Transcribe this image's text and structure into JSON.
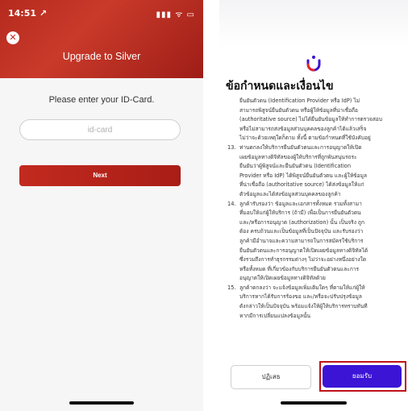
{
  "left_screen": {
    "status_time": "14:51 ↗",
    "status_icons": "▮▮▮ ᯤ ▭",
    "title": "Upgrade to Silver",
    "prompt": "Please enter your ID-Card.",
    "id_placeholder": "id-card",
    "next_label": "Next",
    "close_icon": "close-icon"
  },
  "right_screen": {
    "heading": "ข้อกำหนดและเงื่อนไข",
    "terms": [
      {
        "num": "",
        "line": "ยืนยันตัวตน (Identification Provider หรือ IdP) ไม่"
      },
      {
        "num": "",
        "line": "สามารถพิสูจน์ยืนยันตัวตน หรือผู้ให้ข้อมูลที่น่าเชื่อถือ"
      },
      {
        "num": "",
        "line": "(authoritative source) ไม่ได้ยืนยันข้อมูลให้ทำการตรวจสอบ"
      },
      {
        "num": "",
        "line": "หรือไม่สามารถส่งข้อมูลส่วนบุคคลของลูกค้าได้แล้วเสร็จ"
      },
      {
        "num": "",
        "line": "ไม่ว่าจะด้วยเหตุใดก็ตาม ทั้งนี้ ตามข้อกำหนดที่ใช้บังคับอยู่"
      },
      {
        "num": "13.",
        "line": "ท่านตกลงให้บริการยืนยันตัวตนและการอนุญาตให้เปิด"
      },
      {
        "num": "",
        "line": "เผยข้อมูลทางดิจิทัลของผู้ให้บริการที่ถูกพันสนุนรถระ"
      },
      {
        "num": "",
        "line": "ยืนยันว่าผู้พิสูจน์และยืนยันตัวตน (Identification"
      },
      {
        "num": "",
        "line": "Provider หรือ IdP) ได้พิสูจน์ยืนยันตัวตน และผู้ให้ข้อมูล"
      },
      {
        "num": "",
        "line": "ที่น่าเชื่อถือ (authoritative source) ได้ส่งข้อมูลให้แก่"
      },
      {
        "num": "",
        "line": "ตัวข้อมูลและได้ส่งข้อมูลส่วนบุคคลของลูกค้า"
      },
      {
        "num": "14.",
        "line": "ลูกค้ารับรองว่า ข้อมูลและเอกสารทั้งหมด รวมทั้งสามา"
      },
      {
        "num": "",
        "line": "ที่มอบให้แก่ผู้ให้บริการ (ถ้ามี) เพื่อเป็นการยืนยันตัวตน"
      },
      {
        "num": "",
        "line": "และ/หรือการอนุญาต (authorization) นั้น เป็นจริง ถูก"
      },
      {
        "num": "",
        "line": "ต้อง ครบถ้วนและเป็นข้อมูลที่เป็นปัจจุบัน และรับรองว่า"
      },
      {
        "num": "",
        "line": "ลูกค้ามีอำนาจและความสามารถในการสมัครใช้บริการ"
      },
      {
        "num": "",
        "line": "ยืนยันตัวตนและการอนุญาตให้เปิดเผยข้อมูลทางดิจิทัลได้"
      },
      {
        "num": "",
        "line": "ซึ่งรวมถึงการทำธุรกรรมต่างๆ ไม่ว่าจะอย่างหนึ่งอย่างใด"
      },
      {
        "num": "",
        "line": "หรือทั้งหมด ที่เกี่ยวข้องกับบริการยืนยันตัวตนและการ"
      },
      {
        "num": "",
        "line": "อนุญาตให้เปิดเผยข้อมูลทางดิจิทัลด้วย"
      },
      {
        "num": "15.",
        "line": "ลูกค้าตกลงว่า จะแจ้งข้อมูลเพิ่มเติมใดๆ ที่ตามให้แก่ผู้ให้"
      },
      {
        "num": "",
        "line": "บริการหากได้รับการร้องขอ และ/หรือจะปรับปรุงข้อมูล"
      },
      {
        "num": "",
        "line": "ดังกล่าวให้เป็นปัจจุบัน พร้อมแจ้งให้ผู้ให้บริการทราบทันที"
      },
      {
        "num": "",
        "line": "หากมีการเปลี่ยนแปลงข้อมูลนั้น"
      }
    ],
    "decline_label": "ปฏิเสธ",
    "accept_label": "ยอมรับ",
    "accent_color": "#3b14d6",
    "highlight_color": "#c0111a"
  }
}
